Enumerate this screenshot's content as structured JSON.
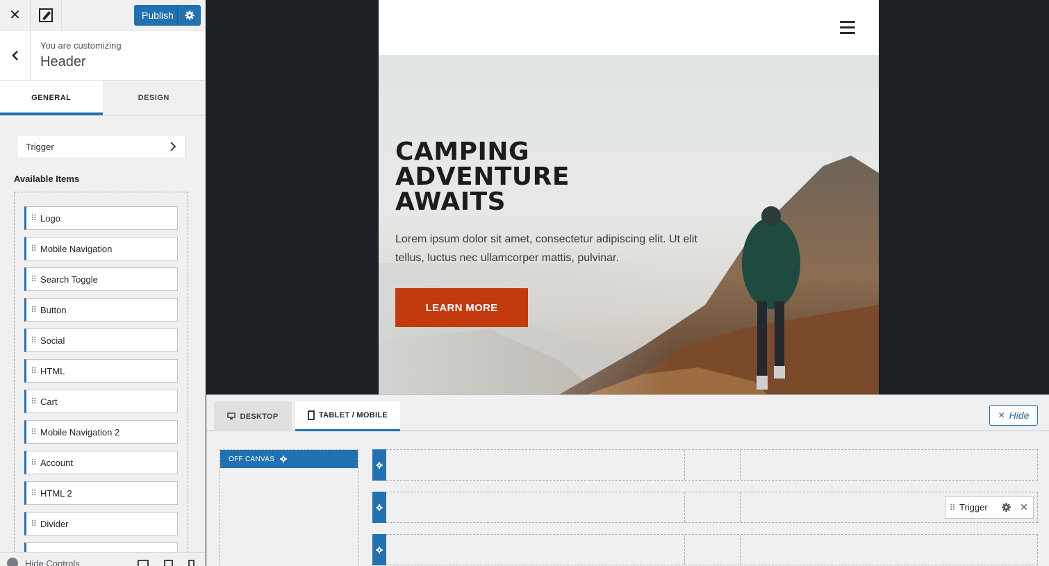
{
  "topbar": {
    "publish_label": "Publish"
  },
  "customizing": {
    "subtitle": "You are customizing",
    "title": "Header"
  },
  "tabs": [
    {
      "label": "GENERAL"
    },
    {
      "label": "DESIGN"
    }
  ],
  "trigger_row": {
    "label": "Trigger"
  },
  "available_items": {
    "title": "Available Items",
    "items": [
      "Logo",
      "Mobile Navigation",
      "Search Toggle",
      "Button",
      "Social",
      "HTML",
      "Cart",
      "Mobile Navigation 2",
      "Account",
      "HTML 2",
      "Divider"
    ]
  },
  "footer": {
    "hide_controls": "Hide Controls"
  },
  "hero": {
    "title_lines": [
      "CAMPING",
      "ADVENTURE",
      "AWAITS"
    ],
    "text": "Lorem ipsum dolor sit amet, consectetur adipiscing elit. Ut elit tellus, luctus nec ullamcorper mattis, pulvinar.",
    "button": "LEARN MORE"
  },
  "builder": {
    "tabs": [
      {
        "label": "DESKTOP"
      },
      {
        "label": "TABLET / MOBILE"
      }
    ],
    "hide_label": "Hide",
    "off_canvas_label": "OFF CANVAS",
    "trigger_chip": "Trigger"
  },
  "colors": {
    "accent": "#2271b1",
    "cta": "#c33a0e",
    "preview_bg": "#1b2125"
  }
}
